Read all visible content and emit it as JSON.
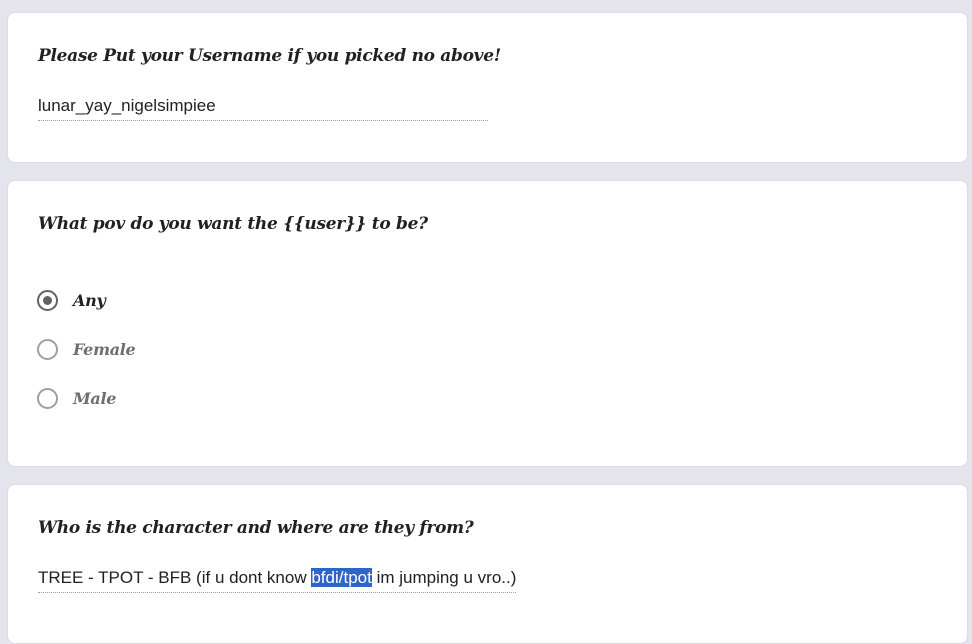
{
  "q1": {
    "question": "Please Put your Username if you picked no above!",
    "answer": "lunar_yay_nigelsimpiee"
  },
  "q2": {
    "question": "What pov do you want the {{user}} to be?",
    "options": [
      {
        "label": "Any",
        "selected": true
      },
      {
        "label": "Female",
        "selected": false
      },
      {
        "label": "Male",
        "selected": false
      }
    ]
  },
  "q3": {
    "question": "Who is the character and where are they from?",
    "answer_before": "TREE - TPOT - BFB (if u dont know ",
    "answer_selected": "bfdi/tpot",
    "answer_after": " im jumping u vro..)"
  },
  "colors": {
    "background": "#e4e4ec",
    "card": "#ffffff",
    "selection": "#2f64c8"
  }
}
